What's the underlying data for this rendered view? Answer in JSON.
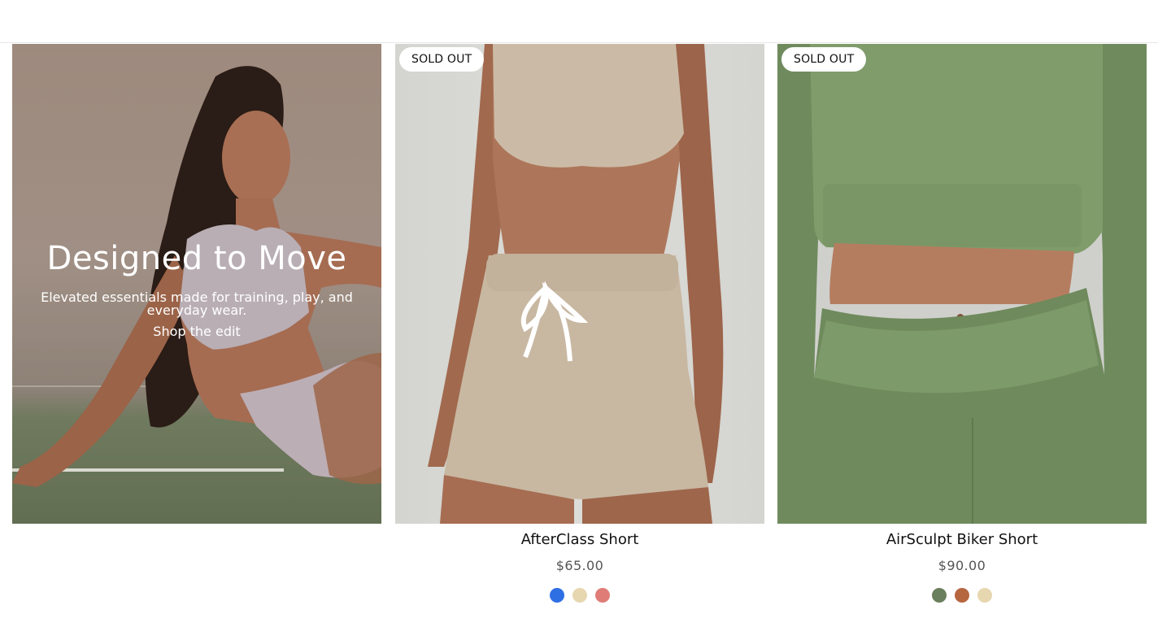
{
  "hero": {
    "title": "Designed to Move",
    "subtitle": "Elevated essentials made for training, play, and everyday wear.",
    "cta_label": "Shop the edit"
  },
  "products": [
    {
      "badge": "SOLD OUT",
      "name": "AfterClass Short",
      "price": "$65.00",
      "swatches": [
        "#2f6fe4",
        "#e7d7b0",
        "#e07c77"
      ]
    },
    {
      "badge": "SOLD OUT",
      "name": "AirSculpt Biker Short",
      "price": "$90.00",
      "swatches": [
        "#6a7f5d",
        "#b5663f",
        "#e7d7b0"
      ]
    }
  ],
  "colors": {
    "hero_tint": "#9e8a7d",
    "floor_green": "#626e52",
    "outfit_lilac": "#b9aeb4",
    "beige_set": "#cbbba6",
    "sage_set": "#7f9c6a"
  }
}
